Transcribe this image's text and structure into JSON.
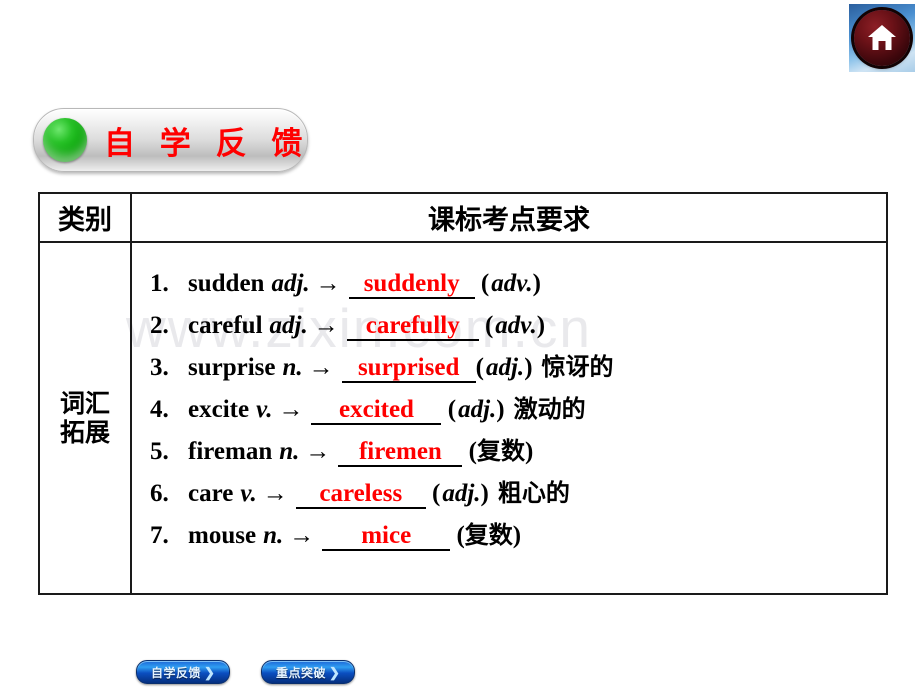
{
  "home_button": {
    "icon": "home-icon",
    "label": "Home"
  },
  "section_title": {
    "text": "自 学 反 馈",
    "bullet_icon": "green-sphere-bullet",
    "accent_color": "#ff0000"
  },
  "watermark": {
    "text": "www.zixin.com.cn"
  },
  "table": {
    "headers": {
      "category": "类别",
      "requirement": "课标考点要求"
    },
    "category_label": "词汇\n拓展",
    "category_label_line1": "词汇",
    "category_label_line2": "拓展",
    "rows": [
      {
        "num": "1.",
        "base": "sudden",
        "pos_from": "adj.",
        "arrow": "→",
        "answer": "suddenly",
        "pos_to": "adv.",
        "note": ""
      },
      {
        "num": "2.",
        "base": "careful",
        "pos_from": "adj.",
        "arrow": "→",
        "answer": "carefully",
        "pos_to": "adv.",
        "note": ""
      },
      {
        "num": "3.",
        "base": "surprise",
        "pos_from": "n.",
        "arrow": "→",
        "answer": "surprised",
        "pos_to": "adj.",
        "note": "惊讶的"
      },
      {
        "num": "4.",
        "base": "excite",
        "pos_from": "v.",
        "arrow": "→",
        "answer": "excited",
        "pos_to": "adj.",
        "note": "激动的"
      },
      {
        "num": "5.",
        "base": "fireman",
        "pos_from": "n.",
        "arrow": "→",
        "answer": "firemen",
        "pos_to": "复数",
        "note": ""
      },
      {
        "num": "6.",
        "base": "care",
        "pos_from": "v.",
        "arrow": "→",
        "answer": "careless",
        "pos_to": "adj.",
        "note": "粗心的"
      },
      {
        "num": "7.",
        "base": "mouse",
        "pos_from": "n.",
        "arrow": "→",
        "answer": "mice",
        "pos_to": "复数",
        "note": ""
      }
    ]
  },
  "bottom_nav": {
    "buttons": [
      {
        "label": "自学反馈",
        "chevron": "❯"
      },
      {
        "label": "重点突破",
        "chevron": "❯"
      }
    ]
  }
}
